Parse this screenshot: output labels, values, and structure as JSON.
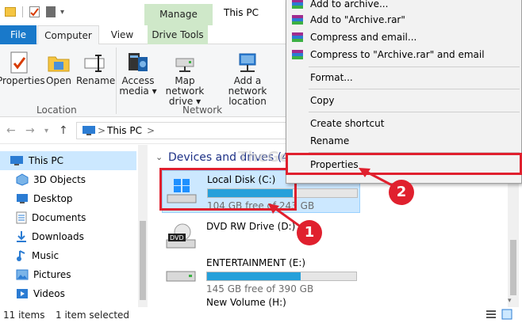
{
  "titlebar": {
    "manage_tab": "Manage",
    "title": "This PC"
  },
  "tabs": {
    "file": "File",
    "computer": "Computer",
    "view": "View",
    "drive_tools": "Drive Tools"
  },
  "ribbon": {
    "properties": "Properties",
    "open": "Open",
    "rename": "Rename",
    "location_group": "Location",
    "access_media_1": "Access",
    "access_media_2": "media ▾",
    "map_network_1": "Map network",
    "map_network_2": "drive ▾",
    "add_network_1": "Add a network",
    "add_network_2": "location",
    "network_group": "Network"
  },
  "address": {
    "path": "This PC",
    "separator": ">"
  },
  "navpane": {
    "items": [
      {
        "label": "This PC",
        "icon": "computer-icon"
      },
      {
        "label": "3D Objects",
        "icon": "cube-icon"
      },
      {
        "label": "Desktop",
        "icon": "desktop-icon"
      },
      {
        "label": "Documents",
        "icon": "documents-icon"
      },
      {
        "label": "Downloads",
        "icon": "downloads-icon"
      },
      {
        "label": "Music",
        "icon": "music-icon"
      },
      {
        "label": "Pictures",
        "icon": "pictures-icon"
      },
      {
        "label": "Videos",
        "icon": "videos-icon"
      }
    ]
  },
  "content": {
    "group_header": "Devices and drives (4)",
    "drives": [
      {
        "name": "Local Disk (C:)",
        "free": "104 GB free of 243 GB",
        "used_fraction": 0.57
      },
      {
        "name": "DVD RW Drive (D:)",
        "free": "",
        "used_fraction": null
      },
      {
        "name": "ENTERTAINMENT (E:)",
        "free": "145 GB free of 390 GB",
        "used_fraction": 0.63
      },
      {
        "name": "New Volume (H:)",
        "free": "",
        "used_fraction": null
      }
    ]
  },
  "context_menu": {
    "items": [
      "Add to archive...",
      "Add to \"Archive.rar\"",
      "Compress and email...",
      "Compress to \"Archive.rar\" and email",
      "Format...",
      "Copy",
      "Create shortcut",
      "Rename",
      "Properties"
    ]
  },
  "annotations": {
    "marker_1": "1",
    "marker_2": "2",
    "watermark": "TheGeekPage.com"
  },
  "status": {
    "items": "11 items",
    "selected": "1 item selected"
  },
  "colors": {
    "accent": "#1979ca",
    "manage_green": "#cfe8c9",
    "selection": "#cce8ff",
    "bar_fill": "#26a0da",
    "annotation_red": "#e0202e"
  }
}
